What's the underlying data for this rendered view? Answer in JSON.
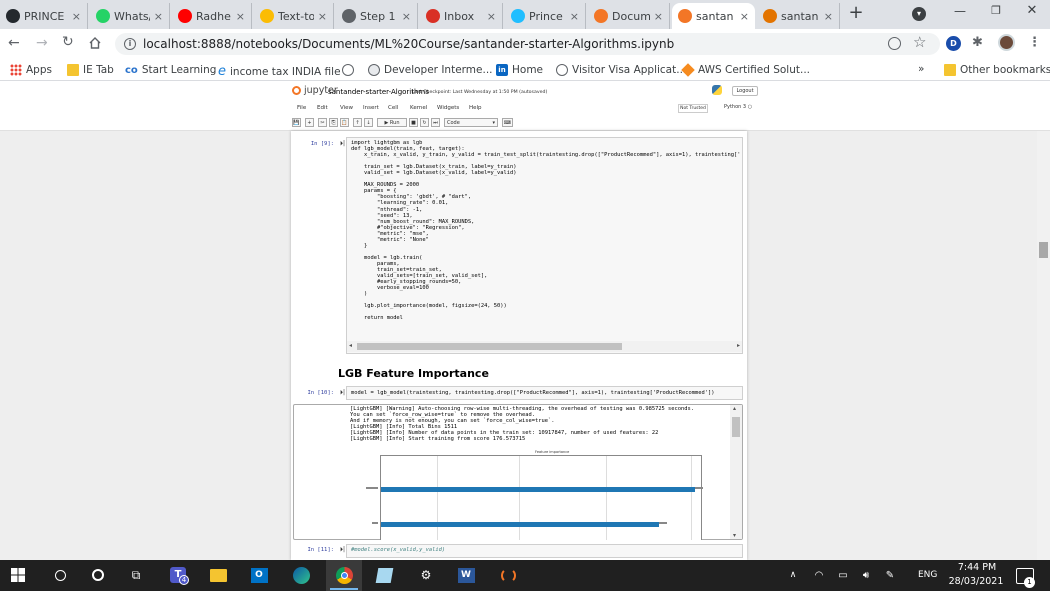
{
  "tabs": [
    {
      "label": "PRINCE",
      "icon": "github-icon",
      "color": "#24292e"
    },
    {
      "label": "Whats/",
      "icon": "whatsapp-icon",
      "color": "#25d366"
    },
    {
      "label": "Radhe",
      "icon": "youtube-icon",
      "color": "#ff0000"
    },
    {
      "label": "Text-to",
      "icon": "drive-icon",
      "color": "#fbbc04"
    },
    {
      "label": "Step 1",
      "icon": "gear-tab-icon",
      "color": "#5f6368"
    },
    {
      "label": "Inbox",
      "icon": "gmail-icon",
      "color": "#d93025"
    },
    {
      "label": "Prince",
      "icon": "kaggle-icon",
      "color": "#20beff"
    },
    {
      "label": "Docum",
      "icon": "jupyter-tab-icon",
      "color": "#f37626"
    },
    {
      "label": "santan",
      "icon": "jupyter-tab-icon",
      "color": "#f37626"
    },
    {
      "label": "santan",
      "icon": "hourglass-tab-icon",
      "color": "#e37400"
    }
  ],
  "address": {
    "url": "localhost:8888/notebooks/Documents/ML%20Course/santander-starter-Algorithms.ipynb"
  },
  "bookmarks": [
    {
      "label": "Apps"
    },
    {
      "label": "IE Tab"
    },
    {
      "label": "Start Learning"
    },
    {
      "label": "income tax INDIA file"
    },
    {
      "label": ""
    },
    {
      "label": "Developer Interme..."
    },
    {
      "label": "Home"
    },
    {
      "label": "Visitor Visa Applicat..."
    },
    {
      "label": "AWS Certified Solut..."
    }
  ],
  "bookmarks_more": "»",
  "other_bookmarks": "Other bookmarks",
  "jupyter": {
    "logo_text": "jupyter",
    "notebook_name": "santander-starter-Algorithms",
    "checkpoint": "Last Checkpoint: Last Wednesday at 1:50 PM",
    "autosaved": "(autosaved)",
    "logout": "Logout",
    "menus": [
      "File",
      "Edit",
      "View",
      "Insert",
      "Cell",
      "Kernel",
      "Widgets",
      "Help"
    ],
    "trusted": "Not Trusted",
    "kernel": "Python 3",
    "run_label": "Run",
    "cell_type": "Code"
  },
  "cells": {
    "cell9_prompt": "In [9]:",
    "cell9_code": "import lightgbm as lgb\ndef lgb_model(train, feat, target):\n    x_train, x_valid, y_train, y_valid = train_test_split(traintesting.drop([\"ProductRecommed\"], axis=1), traintesting['Prod\n\n    train_set = lgb.Dataset(x_train, label=y_train)\n    valid_set = lgb.Dataset(x_valid, label=y_valid)\n\n    MAX_ROUNDS = 2000\n    params = {\n        \"boosting\": 'gbdt', # \"dart\",\n        \"learning_rate\": 0.01,\n        \"nthread\": -1,\n        \"seed\": 13,\n        \"num_boost_round\": MAX_ROUNDS,\n        #\"objective\": \"Regression\",\n        \"metric\": \"mse\",\n        \"metric\": \"None\"\n    }\n\n    model = lgb.train(\n        params,\n        train_set=train_set,\n        valid_sets=[train_set, valid_set],\n        #early_stopping_rounds=50,\n        verbose_eval=100\n    )\n\n    lgb.plot_importance(model, figsize=(24, 50))\n\n    return model",
    "heading": "LGB Feature Importance",
    "cell10_prompt": "In [10]:",
    "cell10_code": "model = lgb_model(traintesting, traintesting.drop([\"ProductRecommed\"], axis=1), traintesting['ProductRecommed'])",
    "cell10_output": "[LightGBM] [Warning] Auto-choosing row-wise multi-threading, the overhead of testing was 0.985725 seconds.\nYou can set `force_row_wise=true` to remove the overhead.\nAnd if memory is not enough, you can set `force_col_wise=true`.\n[LightGBM] [Info] Total Bins 1511\n[LightGBM] [Info] Number of data points in the train set: 10917847, number of used features: 22\n[LightGBM] [Info] Start training from score 176.573715",
    "plot_title": "Feature importance",
    "cell11_prompt": "In [11]:",
    "cell11_code": "#model.score(x_valid,y_valid)"
  },
  "taskbar": {
    "teams_badge": "4",
    "lang": "ENG",
    "time": "7:44 PM",
    "date": "28/03/2021",
    "notif_count": "1"
  }
}
